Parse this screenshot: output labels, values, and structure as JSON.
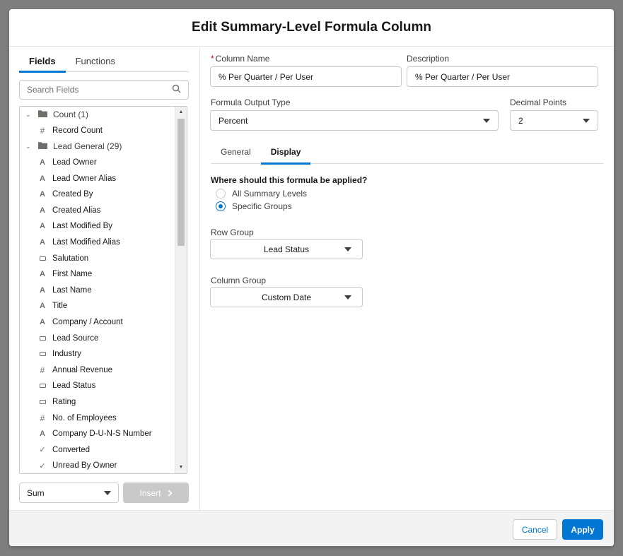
{
  "modal": {
    "title": "Edit Summary-Level Formula Column"
  },
  "left": {
    "tabs": [
      {
        "label": "Fields",
        "active": true
      },
      {
        "label": "Functions",
        "active": false
      }
    ],
    "search": {
      "placeholder": "Search Fields",
      "value": "",
      "icon": "search-icon"
    },
    "tree": [
      {
        "kind": "folder",
        "label": "Count (1)"
      },
      {
        "kind": "field",
        "type": "number",
        "label": "Record Count"
      },
      {
        "kind": "folder",
        "label": "Lead General (29)"
      },
      {
        "kind": "field",
        "type": "text",
        "label": "Lead Owner"
      },
      {
        "kind": "field",
        "type": "text",
        "label": "Lead Owner Alias"
      },
      {
        "kind": "field",
        "type": "text",
        "label": "Created By"
      },
      {
        "kind": "field",
        "type": "text",
        "label": "Created Alias"
      },
      {
        "kind": "field",
        "type": "text",
        "label": "Last Modified By"
      },
      {
        "kind": "field",
        "type": "text",
        "label": "Last Modified Alias"
      },
      {
        "kind": "field",
        "type": "picklist",
        "label": "Salutation"
      },
      {
        "kind": "field",
        "type": "text",
        "label": "First Name"
      },
      {
        "kind": "field",
        "type": "text",
        "label": "Last Name"
      },
      {
        "kind": "field",
        "type": "text",
        "label": "Title"
      },
      {
        "kind": "field",
        "type": "text",
        "label": "Company / Account"
      },
      {
        "kind": "field",
        "type": "picklist",
        "label": "Lead Source"
      },
      {
        "kind": "field",
        "type": "picklist",
        "label": "Industry"
      },
      {
        "kind": "field",
        "type": "number",
        "label": "Annual Revenue"
      },
      {
        "kind": "field",
        "type": "picklist",
        "label": "Lead Status"
      },
      {
        "kind": "field",
        "type": "picklist",
        "label": "Rating"
      },
      {
        "kind": "field",
        "type": "number",
        "label": "No. of Employees"
      },
      {
        "kind": "field",
        "type": "text",
        "label": "Company D-U-N-S Number"
      },
      {
        "kind": "field",
        "type": "checkbox",
        "label": "Converted"
      },
      {
        "kind": "field",
        "type": "checkbox",
        "label": "Unread By Owner"
      }
    ],
    "aggregate": {
      "value": "Sum"
    },
    "insert_label": "Insert"
  },
  "right": {
    "column_name": {
      "label": "Column Name",
      "required_mark": "*",
      "value": "% Per Quarter / Per User"
    },
    "description": {
      "label": "Description",
      "value": "% Per Quarter / Per User"
    },
    "output_type": {
      "label": "Formula Output Type",
      "value": "Percent"
    },
    "decimal_points": {
      "label": "Decimal Points",
      "value": "2"
    },
    "tabs": [
      {
        "label": "General",
        "active": false
      },
      {
        "label": "Display",
        "active": true
      }
    ],
    "apply_question": "Where should this formula be applied?",
    "radios": [
      {
        "label": "All Summary Levels",
        "checked": false
      },
      {
        "label": "Specific Groups",
        "checked": true
      }
    ],
    "row_group": {
      "label": "Row Group",
      "value": "Lead Status"
    },
    "column_group": {
      "label": "Column Group",
      "value": "Custom Date"
    }
  },
  "footer": {
    "cancel_label": "Cancel",
    "apply_label": "Apply"
  },
  "colors": {
    "brand": "#0176d3",
    "required": "#ba0517",
    "disabled_button": "#c9c9c9"
  }
}
